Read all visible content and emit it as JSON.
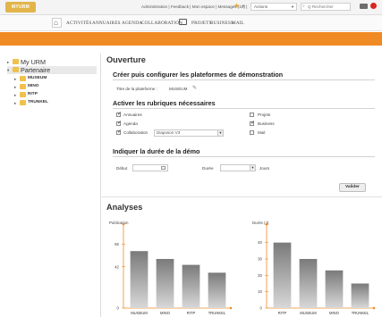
{
  "header": {
    "logo": "MYURM",
    "top_links": "Administration | Feedback | Mon espace | Messages (15) |",
    "actions_select": "Actions",
    "search_placeholder": "Q Rechercher"
  },
  "nav": {
    "items": [
      "ACTIVITÉS",
      "ANNUAIRES",
      "AGENDA",
      "COLLABORATION",
      "PROJETS",
      "BUSINESS",
      "MAIL"
    ]
  },
  "sidebar": {
    "items": [
      {
        "label": "My URM"
      },
      {
        "label": "Partenaire"
      },
      {
        "label": "MUSEUM"
      },
      {
        "label": "MINO"
      },
      {
        "label": "RITP"
      },
      {
        "label": "TRUNKEL"
      }
    ]
  },
  "main": {
    "title": "Ouverture",
    "section1": {
      "heading": "Créer puis configurer les plateformes de démonstration",
      "platform_label": "Titre de la plateforme :",
      "platform_value": "MUSEUM"
    },
    "section2": {
      "heading": "Activer les rubriques nécessaires",
      "left": [
        {
          "label": "Annuaires",
          "checked": true
        },
        {
          "label": "Agenda",
          "checked": true
        },
        {
          "label": "Collaboration",
          "checked": true
        }
      ],
      "collab_select": "Diaposon V3",
      "right": [
        {
          "label": "Projets",
          "checked": false
        },
        {
          "label": "Business",
          "checked": true
        },
        {
          "label": "Mail",
          "checked": false
        }
      ]
    },
    "section3": {
      "heading": "Indiquer la durée de la démo",
      "start_label": "Début",
      "duration_label": "Durée",
      "unit_label": "Jours",
      "validate": "Valider"
    },
    "analyses_title": "Analyses"
  },
  "chart_data": [
    {
      "type": "bar",
      "ylabel": "Publication",
      "categories": [
        "MUSEUM",
        "MINO",
        "RITP",
        "TRUNKEL"
      ],
      "values": [
        58,
        50,
        44,
        36
      ],
      "ytick_labels": [
        "65",
        "42",
        "0"
      ],
      "yticks": [
        65,
        42,
        0
      ],
      "ylim": [
        0,
        80
      ],
      "color": "#9a9a9a"
    },
    {
      "type": "bar",
      "ylabel": "Durée (J)",
      "categories": [
        "RITP",
        "MUSEUM",
        "MINO",
        "TRUNKEL"
      ],
      "values": [
        40,
        30,
        23,
        15
      ],
      "ytick_labels": [
        "40",
        "30",
        "20",
        "10",
        "0"
      ],
      "yticks": [
        40,
        30,
        20,
        10,
        0
      ],
      "ylim": [
        0,
        48
      ],
      "color": "#9a9a9a"
    }
  ],
  "colors": {
    "accent": "#f08a24",
    "logo": "#e2b54b",
    "bar": "#9a9a9a"
  }
}
